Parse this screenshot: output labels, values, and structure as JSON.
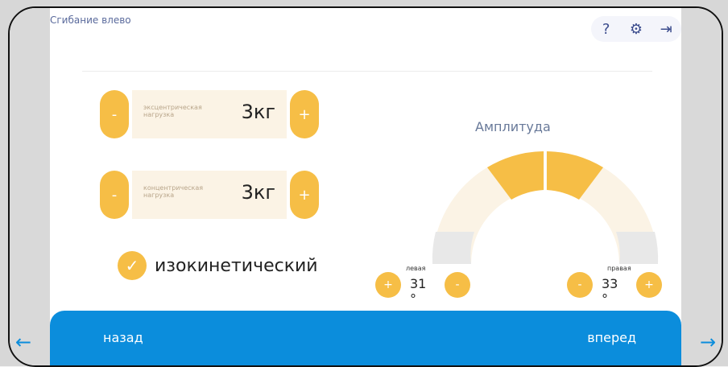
{
  "header": {
    "title": "Сгибание влево",
    "help_icon": "?",
    "settings_icon": "⚙",
    "logout_icon": "⇥"
  },
  "controls": {
    "eccentric": {
      "label": "эксцентрическая нагрузка",
      "value": "3кг",
      "minus": "-",
      "plus": "+"
    },
    "concentric": {
      "label": "концентрическая нагрузка",
      "value": "3кг",
      "minus": "-",
      "plus": "+"
    },
    "isokinetic": {
      "label": "изокинетический",
      "checked": true
    }
  },
  "amplitude": {
    "title": "Амплитуда",
    "left": {
      "label": "левая",
      "value": "31 °",
      "plus": "+",
      "minus": "-"
    },
    "right": {
      "label": "правая",
      "value": "33 °",
      "minus": "-",
      "plus": "+"
    }
  },
  "footer": {
    "back": "назад",
    "forward": "вперед"
  },
  "colors": {
    "accent": "#f6be46",
    "bar": "#0b8ddc",
    "arc_light": "#fbf3e5",
    "arc_gray": "#e8e8e8"
  }
}
